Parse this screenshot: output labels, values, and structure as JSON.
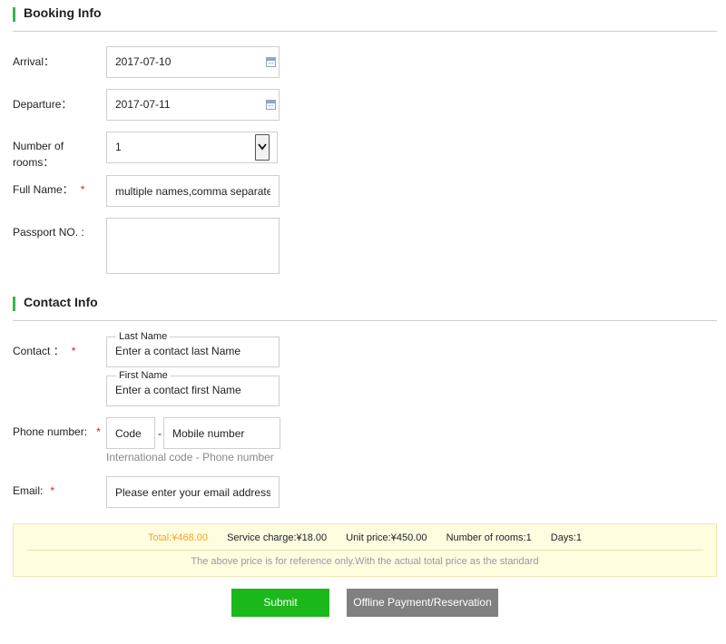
{
  "booking": {
    "title": "Booking Info",
    "arrival_label": "Arrival：",
    "arrival_value": "2017-07-10",
    "departure_label": "Departure：",
    "departure_value": "2017-07-11",
    "rooms_label_line1": "Number of",
    "rooms_label_line2": "rooms：",
    "rooms_value": "1",
    "fullname_label": "Full Name：",
    "fullname_placeholder": "multiple names,comma separated",
    "passport_label": "Passport NO. :",
    "passport_value": ""
  },
  "contact": {
    "title": "Contact Info",
    "contact_label": "Contact ：",
    "last_name_legend": "Last Name",
    "last_name_placeholder": "Enter a contact last Name",
    "first_name_legend": "First Name",
    "first_name_placeholder": "Enter a contact first Name",
    "phone_label": "Phone number:",
    "code_placeholder": "Code",
    "separator": "-",
    "mobile_placeholder": "Mobile number",
    "phone_hint": "International code - Phone number",
    "email_label": "Email:",
    "email_placeholder": "Please enter your email address",
    "required_mark": "*"
  },
  "summary": {
    "total": "Total:¥468.00",
    "service_charge": "Service charge:¥18.00",
    "unit_price": "Unit price:¥450.00",
    "rooms": "Number of rooms:1",
    "days": "Days:1",
    "note": "The above price is for reference only.With the actual total price as the standard"
  },
  "buttons": {
    "submit": "Submit",
    "offline": "Offline Payment/Reservation"
  },
  "colors": {
    "accent_green": "#3ab54a",
    "submit_green": "#1bb81b",
    "total_orange": "#f5a623",
    "required_red": "#e02020",
    "summary_bg": "#fffde0"
  }
}
